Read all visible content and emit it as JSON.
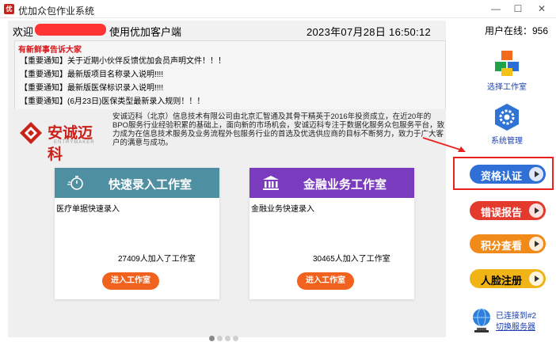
{
  "window": {
    "title": "优加众包作业系统",
    "icon_color": "#c9221b"
  },
  "header": {
    "welcome": "欢迎",
    "welcome_suffix": "使用优加客户端",
    "datetime": "2023年07月28日 16:50:12"
  },
  "notices": {
    "title": "有新鲜事告诉大家",
    "items": [
      "【重要通知】关于近期小伙伴反馈优加会员声明文件！！！",
      "【重要通知】最新版项目名称录入说明!!!!",
      "【重要通知】最新版医保标识录入说明!!!!",
      "【重要通知】(6月23日)医保类型最新录入规则！！！"
    ]
  },
  "company": {
    "logo_text": "安诚迈科",
    "logo_sub": "ENTRYMAKER",
    "description": "安诚迈科（北京）信息技术有限公司由北京汇智通及其骨干精英于2016年投资成立，在近20年的BPO服务行业经验积累的基础上，面向新的市场机会，安诚迈科专注于数据化服务众包服务平台，致力成为在信息技术服务及业务流程外包服务行业的首选及优选供应商的目标不断努力，致力于广大客户的满意与成功。"
  },
  "cards": [
    {
      "title": "快速录入工作室",
      "subtitle": "医疗单据快速录入",
      "count": "27409人加入了工作室",
      "button": "进入工作室",
      "color": "#4f8fa2",
      "icon": "stopwatch-icon"
    },
    {
      "title": "金融业务工作室",
      "subtitle": "金融业务快速录入",
      "count": "30465人加入了工作室",
      "button": "进入工作室",
      "color": "#7a3bbf",
      "icon": "bank-icon"
    }
  ],
  "sidebar": {
    "online": "用户在线：956",
    "select_studio": "选择工作室",
    "system_manage": "系统管理",
    "buttons": [
      {
        "label": "资格认证",
        "color": "#2f6fd6"
      },
      {
        "label": "错误报告",
        "color": "#e43a2d"
      },
      {
        "label": "积分查看",
        "color": "#f08a18"
      },
      {
        "label": "人脸注册",
        "color": "#f0b416"
      }
    ],
    "server_connected": "已连接到#2",
    "switch_server": "切换服务器"
  },
  "theme": {
    "highlight": "#e8231f",
    "accent": "#f0621e"
  }
}
